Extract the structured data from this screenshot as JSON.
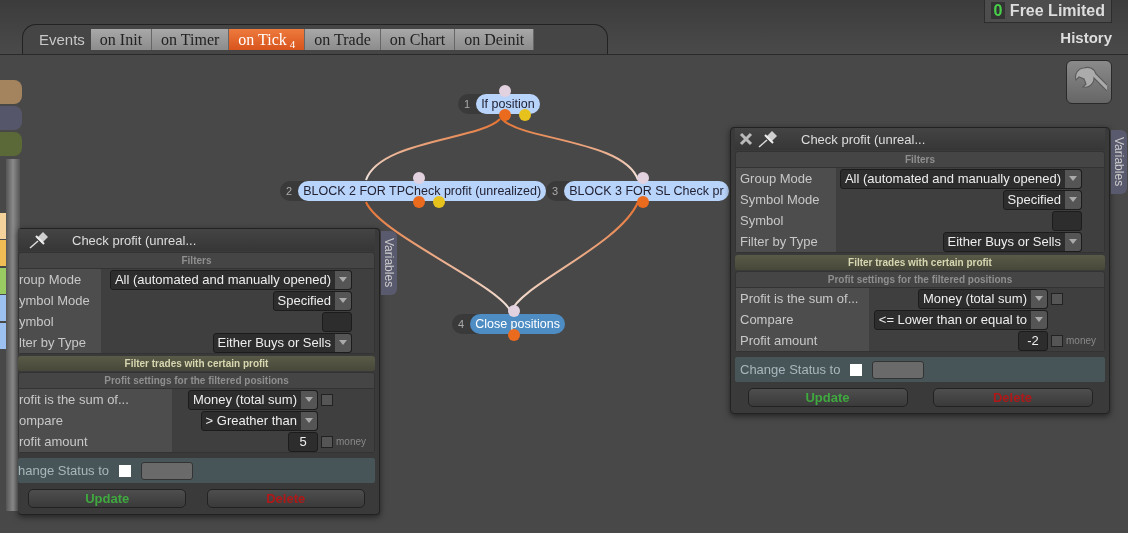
{
  "account": {
    "counter": "0",
    "plan": "Free Limited",
    "history": "History"
  },
  "events_label": "Events",
  "tabs": [
    {
      "label": "on Init",
      "selected": false
    },
    {
      "label": "on Timer",
      "selected": false
    },
    {
      "label": "on Tick",
      "selected": true,
      "badge": "4"
    },
    {
      "label": "on Trade",
      "selected": false
    },
    {
      "label": "on Chart",
      "selected": false
    },
    {
      "label": "on Deinit",
      "selected": false
    }
  ],
  "palette": [
    {
      "color": "#a4845f"
    },
    {
      "color": "#56566b"
    },
    {
      "color": "#5b6837"
    }
  ],
  "stripes": [
    {
      "color": "#f3d39b"
    },
    {
      "color": "#f1bd55"
    },
    {
      "color": "#9acb63"
    },
    {
      "color": "#9cc0f0"
    },
    {
      "color": "#9cc0f0"
    }
  ],
  "nodes": [
    {
      "number": "1",
      "label": "If position",
      "selected": false
    },
    {
      "number": "2",
      "label": "BLOCK 2 FOR TPCheck profit (unrealized)",
      "selected": false
    },
    {
      "number": "3",
      "label": "BLOCK 3 FOR SL Check pr",
      "selected": false
    },
    {
      "number": "4",
      "label": "Close positions",
      "selected": true
    }
  ],
  "dialogs": [
    {
      "title": "Check profit (unreal...",
      "closable": false,
      "side_tab": "Variables",
      "filters_heading": "Filters",
      "filters": [
        {
          "label": "roup Mode",
          "kind": "select",
          "value": "All (automated and manually opened)"
        },
        {
          "label": "ymbol Mode",
          "kind": "select",
          "value": "Specified"
        },
        {
          "label": "ymbol",
          "kind": "field"
        },
        {
          "label": "lter by Type",
          "kind": "select",
          "value": "Either Buys or Sells"
        }
      ],
      "band": "Filter trades with certain profit",
      "profit_heading": "Profit settings for the filtered positions",
      "profit": [
        {
          "label": "rofit is the sum of...",
          "kind": "select",
          "value": "Money (total sum)",
          "checked": false
        },
        {
          "label": "ompare",
          "kind": "select",
          "value": "> Greather than"
        },
        {
          "label": "rofit amount",
          "kind": "field",
          "value": "5",
          "checked": false,
          "unit": "money"
        }
      ],
      "status": {
        "label": "hange Status to",
        "checked": false
      },
      "buttons": [
        {
          "label": "Update",
          "kind": "update"
        },
        {
          "label": "Delete",
          "kind": "delete"
        }
      ]
    },
    {
      "title": "Check profit (unreal...",
      "closable": true,
      "side_tab": "Variables",
      "filters_heading": "Filters",
      "filters": [
        {
          "label": "Group Mode",
          "kind": "select",
          "value": "All (automated and manually opened)"
        },
        {
          "label": "Symbol Mode",
          "kind": "select",
          "value": "Specified"
        },
        {
          "label": "Symbol",
          "kind": "field"
        },
        {
          "label": "Filter by Type",
          "kind": "select",
          "value": "Either Buys or Sells"
        }
      ],
      "band": "Filter trades with certain profit",
      "profit_heading": "Profit settings for the filtered positions",
      "profit": [
        {
          "label": "Profit is the sum of...",
          "kind": "select",
          "value": "Money (total sum)",
          "checked": false
        },
        {
          "label": "Compare",
          "kind": "select",
          "value": "<= Lower than or equal to"
        },
        {
          "label": "Profit amount",
          "kind": "field",
          "value": "-2",
          "checked": false,
          "unit": "money"
        }
      ],
      "status": {
        "label": "Change Status to",
        "checked": false
      },
      "buttons": [
        {
          "label": "Update",
          "kind": "update"
        },
        {
          "label": "Delete",
          "kind": "delete"
        }
      ]
    }
  ]
}
